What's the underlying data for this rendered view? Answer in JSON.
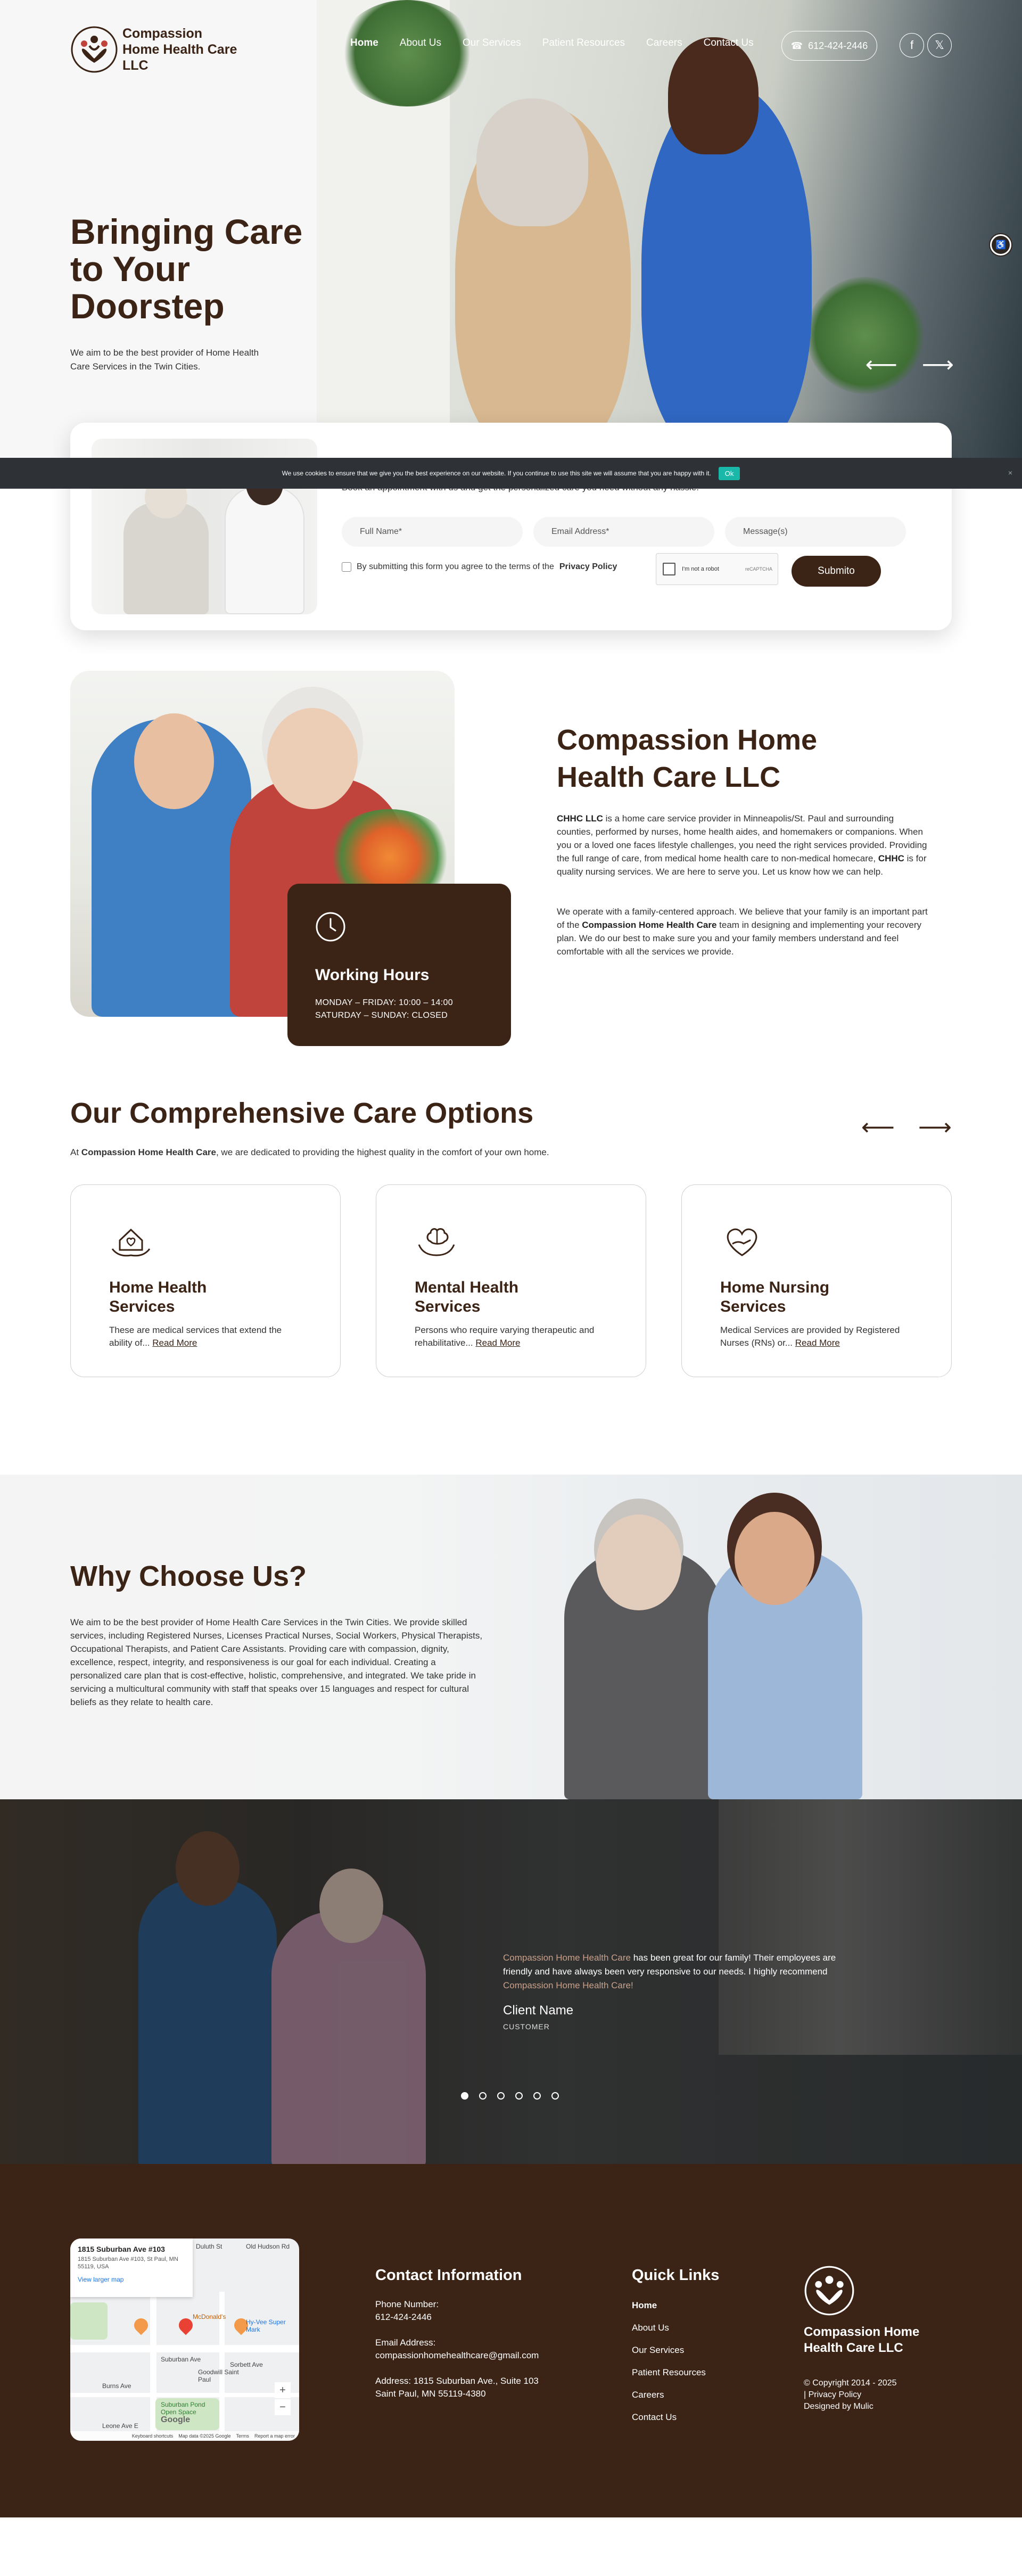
{
  "brand": {
    "name": "Compassion Home Health Care LLC",
    "logo_icon": "three-people-heart-icon"
  },
  "nav": {
    "items": [
      "Home",
      "About Us",
      "Our Services",
      "Patient Resources",
      "Careers",
      "Contact Us"
    ],
    "active": "Home",
    "phone": "612-424-2446"
  },
  "social": {
    "facebook": "f",
    "x": "𝕏"
  },
  "hero": {
    "title": "Bringing Care to Your Doorstep",
    "subtitle": "We aim to be the best provider of Home Health Care Services in the Twin Cities.",
    "prev": "⟵",
    "next": "⟶"
  },
  "cookie": {
    "text": "We use cookies to ensure that we give you the best experience on our website. If you continue to use this site we will assume that you are happy with it.",
    "ok": "Ok",
    "close": "×"
  },
  "booking": {
    "subtitle": "Book an appointment with us and get the personalized care you need without any hassle.",
    "fields": [
      "Full Name*",
      "Email Address*",
      "Message(s)"
    ],
    "consent_prefix": "By submitting this form you agree to the terms of the",
    "consent_link": "Privacy Policy",
    "captcha_label": "I'm not a robot",
    "captcha_brand": "reCAPTCHA",
    "submit": "Submito"
  },
  "about": {
    "title": "Compassion Home Health Care LLC",
    "p1_a": "CHHC LLC",
    "p1_b": " is a home care service provider in Minneapolis/St. Paul and surrounding counties, performed by nurses, home health aides, and homemakers or companions. When you or a loved one faces lifestyle challenges, you need the right services provided. Providing the full range of care, from medical home health care to non-medical homecare, ",
    "p1_c": "CHHC",
    "p1_d": " is for quality nursing services. We are here to serve you. Let us know how we can help.",
    "p2_a": "We operate with a family-centered approach. We believe that your family is an important part of the ",
    "p2_b": "Compassion Home Health Care",
    "p2_c": " team in designing and implementing your recovery plan. We do our best to make sure you and your family members understand and feel comfortable with all the services we provide.",
    "hours_title": "Working Hours",
    "hours_1": "MONDAY – FRIDAY: 10:00 – 14:00",
    "hours_2": "SATURDAY – SUNDAY: CLOSED"
  },
  "services": {
    "title": "Our Comprehensive Care Options",
    "sub_a": "At ",
    "sub_b": "Compassion Home Health Care",
    "sub_c": ", we are dedicated to providing the highest quality in the comfort of your own home.",
    "prev": "⟵",
    "next": "⟶",
    "read_more": "Read More",
    "cards": [
      {
        "title": "Home Health Services",
        "text": "These are medical services that extend the ability of...",
        "icon": "house-hands-icon"
      },
      {
        "title": "Mental Health Services",
        "text": "Persons who require varying therapeutic and rehabilitative...",
        "icon": "brain-hands-icon"
      },
      {
        "title": "Home Nursing Services",
        "text": "Medical Services are provided by Registered Nurses (RNs) or...",
        "icon": "heart-hand-icon"
      }
    ]
  },
  "why": {
    "title": "Why Choose Us?",
    "text": "We aim to be the best provider of Home Health Care Services in the Twin Cities. We provide skilled services, including Registered Nurses, Licenses Practical Nurses, Social Workers, Physical Therapists, Occupational Therapists, and Patient Care Assistants. Providing care with compassion, dignity, excellence, respect, integrity, and responsiveness is our goal for each individual. Creating a personalized care plan that is cost-effective, holistic, comprehensive, and integrated. We take pride in servicing a multicultural community with staff that speaks over 15 languages and respect for cultural beliefs as they relate to health care."
  },
  "testimonial": {
    "q1": "Compassion Home Health Care",
    "q2": " has been great for our family! Their employees are friendly and have always been very responsive to our needs. I highly recommend ",
    "q3": "Compassion Home Health Care!",
    "name": "Client Name",
    "role": "CUSTOMER",
    "dots": 6,
    "active_dot": 0
  },
  "footer": {
    "map": {
      "title": "1815 Suburban Ave #103",
      "address": "1815 Suburban Ave #103, St Paul, MN 55119, USA",
      "link": "View larger map",
      "labels": [
        "McDonald's",
        "Hy-Vee Super Mark",
        "Suburban Ave",
        "Goodwill Saint Paul",
        "Burns Ave",
        "Suburban Pond Open Space",
        "Leone Ave E",
        "Old Hudson Rd",
        "Duluth St",
        "Sorbett Ave"
      ],
      "google": "Google",
      "credits": [
        "Keyboard shortcuts",
        "Map data ©2025 Google",
        "Terms",
        "Report a map error"
      ],
      "zoom_in": "+",
      "zoom_out": "−"
    },
    "contact": {
      "heading": "Contact Information",
      "phone_label": "Phone Number:",
      "phone": "612-424-2446",
      "email_label": "Email Address:",
      "email": "compassionhomehealthcare@gmail.com",
      "address_1": "Address: 1815 Suburban Ave., Suite 103",
      "address_2": "Saint Paul, MN 55119-4380"
    },
    "links": {
      "heading": "Quick Links",
      "items": [
        "Home",
        "About Us",
        "Our Services",
        "Patient Resources",
        "Careers",
        "Contact Us"
      ]
    },
    "brand_name": "Compassion Home Health Care LLC",
    "copyright": "© Copyright 2014 - 2025",
    "privacy": "| Privacy Policy",
    "designed": "Designed by Mulic"
  },
  "colors": {
    "brand_brown": "#3b2416",
    "cookie_ok": "#19b8a8",
    "footer_bg": "#3b2416"
  }
}
